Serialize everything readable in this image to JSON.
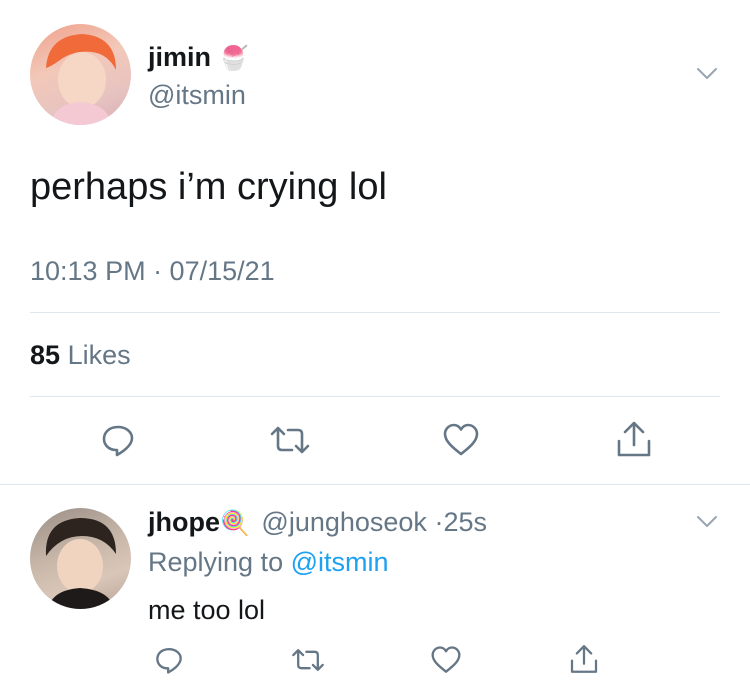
{
  "tweet": {
    "author_name": "jimin",
    "author_handle": "@itsmin",
    "author_emoji": "🍧",
    "body": "perhaps i’m crying lol",
    "timestamp": "10:13 PM · 07/15/21",
    "likes_count": "85",
    "likes_label": "Likes"
  },
  "reply": {
    "author_name": "jhope",
    "author_emoji": "🍭",
    "author_handle": "@junghoseok",
    "time_sep": "·",
    "age": "25s",
    "replying_prefix": "Replying to",
    "replying_handle": "@itsmin",
    "body": "me too lol"
  },
  "icons": {
    "menu": "chevron-down-icon",
    "reply": "reply-icon",
    "retweet": "retweet-icon",
    "like": "heart-icon",
    "share": "share-icon"
  },
  "colors": {
    "text": "#14171a",
    "muted": "#657786",
    "link": "#1da1f2",
    "divider": "#e1e8ed"
  }
}
